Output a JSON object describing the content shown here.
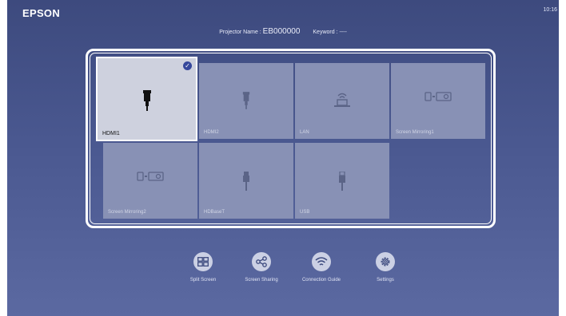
{
  "header": {
    "brand": "EPSON",
    "time": "10:16",
    "projector_name_label": "Projector Name : ",
    "projector_name": "EB000000",
    "keyword_label": "Keyword : ",
    "keyword": "----"
  },
  "sources": [
    {
      "label": "HDMI1",
      "icon": "hdmi-plug-icon",
      "selected": true
    },
    {
      "label": "HDMI2",
      "icon": "hdmi-plug-icon",
      "selected": false
    },
    {
      "label": "LAN",
      "icon": "lan-network-icon",
      "selected": false
    },
    {
      "label": "Screen Mirroring1",
      "icon": "screen-mirroring-icon",
      "selected": false
    },
    {
      "label": "Screen Mirroring2",
      "icon": "screen-mirroring-icon",
      "selected": false
    },
    {
      "label": "HDBaseT",
      "icon": "hdbaset-plug-icon",
      "selected": false
    },
    {
      "label": "USB",
      "icon": "usb-plug-icon",
      "selected": false
    }
  ],
  "actions": [
    {
      "label": "Split Screen",
      "icon": "split-screen-icon"
    },
    {
      "label": "Screen Sharing",
      "icon": "share-icon"
    },
    {
      "label": "Connection Guide",
      "icon": "wifi-icon"
    },
    {
      "label": "Settings",
      "icon": "gear-icon"
    }
  ],
  "colors": {
    "background_top": "#3d4a7e",
    "background_bottom": "#5b69a1",
    "tile": "#8891b5",
    "tile_selected": "#ced1de",
    "check_badge": "#35479b"
  }
}
